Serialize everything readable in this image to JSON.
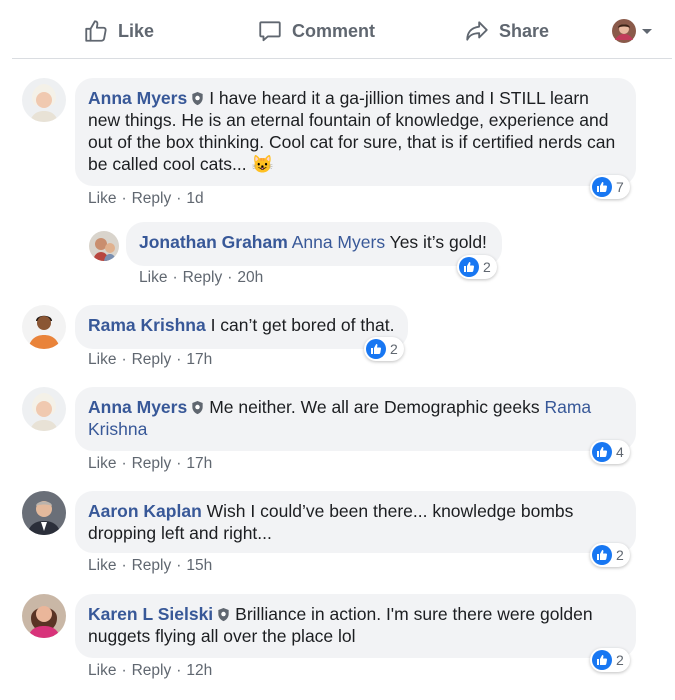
{
  "actions": {
    "like_label": "Like",
    "comment_label": "Comment",
    "share_label": "Share"
  },
  "colors": {
    "link": "#385898",
    "bubble_bg": "#f2f3f5",
    "meta_text": "#606770",
    "like_blue": "#1877f2"
  },
  "comments": [
    {
      "author": "Anna Myers",
      "verified_badge": true,
      "text": "I have heard it a ga-jillion times and I STILL learn new things. He is an eternal fountain of knowledge, experience and out of the box thinking. Cool cat for sure, that is if certified nerds can be called cool cats...",
      "emoji": "😺",
      "like": "Like",
      "reply": "Reply",
      "time": "1d",
      "reaction_count": "7"
    },
    {
      "author": "Jonathan Graham",
      "mention": "Anna Myers",
      "text": "Yes it’s gold!",
      "like": "Like",
      "reply": "Reply",
      "time": "20h",
      "reaction_count": "2"
    },
    {
      "author": "Rama Krishna",
      "text": "I can’t get bored of that.",
      "like": "Like",
      "reply": "Reply",
      "time": "17h",
      "reaction_count": "2"
    },
    {
      "author": "Anna Myers",
      "verified_badge": true,
      "text": "Me neither. We all are Demographic geeks",
      "mention": "Rama Krishna",
      "like": "Like",
      "reply": "Reply",
      "time": "17h",
      "reaction_count": "4"
    },
    {
      "author": "Aaron Kaplan",
      "text": "Wish I could’ve been there... knowledge bombs dropping left and right...",
      "like": "Like",
      "reply": "Reply",
      "time": "15h",
      "reaction_count": "2"
    },
    {
      "author": "Karen L Sielski",
      "verified_badge": true,
      "text": "Brilliance in action. I'm sure there were golden nuggets flying all over the place lol",
      "like": "Like",
      "reply": "Reply",
      "time": "12h",
      "reaction_count": "2"
    }
  ],
  "meta_separator": "·"
}
